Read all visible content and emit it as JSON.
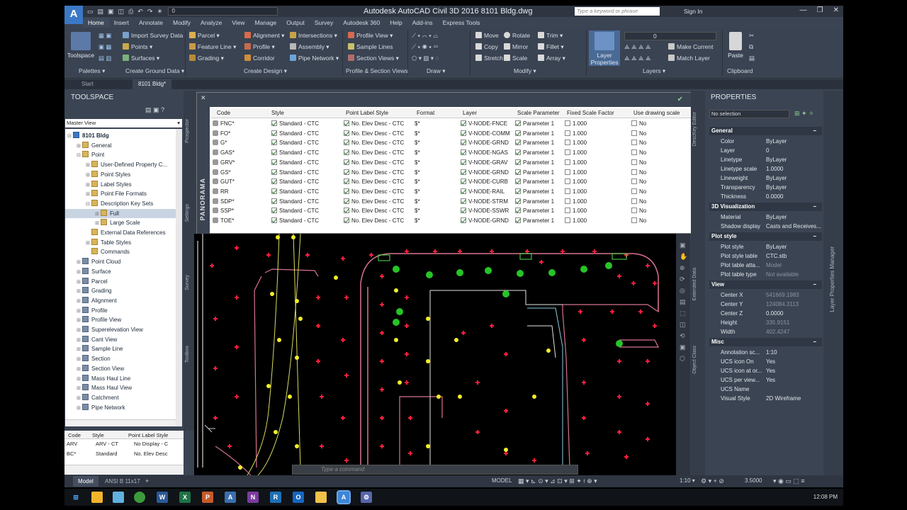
{
  "titlebar": {
    "app_icon": "A",
    "qat_items": [
      "new-icon",
      "open-icon",
      "save-icon",
      "saveas-icon",
      "print-icon",
      "undo-icon",
      "redo-icon",
      "layer-icon"
    ],
    "workspace_value": "0",
    "title": "Autodesk AutoCAD Civil 3D 2016   8101 Bldg.dwg",
    "search_placeholder": "Type a keyword or phrase",
    "signin": "Sign In",
    "window_controls": [
      "—",
      "❐",
      "✕"
    ]
  },
  "ribbon_tabs": [
    "Home",
    "Insert",
    "Annotate",
    "Modify",
    "Analyze",
    "View",
    "Manage",
    "Output",
    "Survey",
    "Autodesk 360",
    "Help",
    "Add-ins",
    "Express Tools"
  ],
  "ribbon": {
    "toolspace": "Toolspace",
    "import_survey": "Import Survey Data",
    "points": "Points",
    "surfaces": "Surfaces",
    "parcel": "Parcel",
    "feature_line": "Feature Line",
    "grading": "Grading",
    "alignment": "Alignment",
    "profile": "Profile",
    "corridor": "Corridor",
    "intersections": "Intersections",
    "assembly": "Assembly",
    "pipe_network": "Pipe Network",
    "profile_view": "Profile View",
    "sample_lines": "Sample Lines",
    "section_views": "Section Views",
    "move": "Move",
    "rotate": "Rotate",
    "trim": "Trim",
    "copy": "Copy",
    "mirror": "Mirror",
    "fillet": "Fillet",
    "stretch": "Stretch",
    "scale": "Scale",
    "array": "Array",
    "layer_properties": "Layer Properties",
    "make_current": "Make Current",
    "match_layer": "Match Layer",
    "layer_combo": "0",
    "paste": "Paste",
    "panels": [
      "Palettes",
      "Create Ground Data",
      "Create Design",
      "Profile & Section Views",
      "Draw",
      "Modify",
      "Layers",
      "Clipboard"
    ]
  },
  "file_tabs": [
    "Start",
    "8101 Bldg*"
  ],
  "toolspace": {
    "title": "TOOLSPACE",
    "view": "Master View",
    "side_tabs": [
      "Prospector",
      "Settings",
      "Survey",
      "Toolbox"
    ],
    "tree": [
      {
        "label": "8101 Bldg",
        "level": 0,
        "tog": "–",
        "bold": true
      },
      {
        "label": "General",
        "level": 1,
        "tog": "+"
      },
      {
        "label": "Point",
        "level": 1,
        "tog": "–"
      },
      {
        "label": "User-Defined Property C...",
        "level": 2,
        "tog": "+"
      },
      {
        "label": "Point Styles",
        "level": 2,
        "tog": "+"
      },
      {
        "label": "Label Styles",
        "level": 2,
        "tog": "+"
      },
      {
        "label": "Point File Formats",
        "level": 2,
        "tog": "+"
      },
      {
        "label": "Description Key Sets",
        "level": 2,
        "tog": "–"
      },
      {
        "label": "Full",
        "level": 3,
        "tog": "+",
        "selected": true
      },
      {
        "label": "Large Scale",
        "level": 3,
        "tog": "+"
      },
      {
        "label": "External Data References",
        "level": 2,
        "tog": ""
      },
      {
        "label": "Table Styles",
        "level": 2,
        "tog": "+"
      },
      {
        "label": "Commands",
        "level": 2,
        "tog": ""
      },
      {
        "label": "Point Cloud",
        "level": 1,
        "tog": "+"
      },
      {
        "label": "Surface",
        "level": 1,
        "tog": "+"
      },
      {
        "label": "Parcel",
        "level": 1,
        "tog": "+"
      },
      {
        "label": "Grading",
        "level": 1,
        "tog": "+"
      },
      {
        "label": "Alignment",
        "level": 1,
        "tog": "+"
      },
      {
        "label": "Profile",
        "level": 1,
        "tog": "+"
      },
      {
        "label": "Profile View",
        "level": 1,
        "tog": "+"
      },
      {
        "label": "Superelevation View",
        "level": 1,
        "tog": "+"
      },
      {
        "label": "Cant View",
        "level": 1,
        "tog": "+"
      },
      {
        "label": "Sample Line",
        "level": 1,
        "tog": "+"
      },
      {
        "label": "Section",
        "level": 1,
        "tog": "+"
      },
      {
        "label": "Section View",
        "level": 1,
        "tog": "+"
      },
      {
        "label": "Mass Haul Line",
        "level": 1,
        "tog": "+"
      },
      {
        "label": "Mass Haul View",
        "level": 1,
        "tog": "+"
      },
      {
        "label": "Catchment",
        "level": 1,
        "tog": "+"
      },
      {
        "label": "Pipe Network",
        "level": 1,
        "tog": "+"
      }
    ],
    "mini_headers": [
      "Code",
      "Style",
      "Point Label Style"
    ],
    "mini_rows": [
      [
        "ARV",
        "ARV - CT",
        "No Display - C"
      ],
      [
        "BC*",
        "Standard",
        "No. Elev Desc"
      ]
    ]
  },
  "panorama": {
    "label": "PANORAMA",
    "headers": [
      "Code",
      "Style",
      "Point Label Style",
      "Format",
      "Layer",
      "Scale Parameter",
      "Fixed Scale Factor",
      "Use drawing scale"
    ],
    "rows": [
      [
        "FNC*",
        "Standard - CTC",
        "No. Elev Desc - CTC",
        "$*",
        "V-NODE-FNCE",
        "Parameter 1",
        "1.000",
        "No"
      ],
      [
        "FO*",
        "Standard - CTC",
        "No. Elev Desc - CTC",
        "$*",
        "V-NODE-COMM",
        "Parameter 1",
        "1.000",
        "No"
      ],
      [
        "G*",
        "Standard - CTC",
        "No. Elev Desc - CTC",
        "$*",
        "V-NODE-GRND",
        "Parameter 1",
        "1.000",
        "No"
      ],
      [
        "GAS*",
        "Standard - CTC",
        "No. Elev Desc - CTC",
        "$*",
        "V-NODE-NGAS",
        "Parameter 1",
        "1.000",
        "No"
      ],
      [
        "GRV*",
        "Standard - CTC",
        "No. Elev Desc - CTC",
        "$*",
        "V-NODE-GRAV",
        "Parameter 1",
        "1.000",
        "No"
      ],
      [
        "GS*",
        "Standard - CTC",
        "No. Elev Desc - CTC",
        "$*",
        "V-NODE-GRND",
        "Parameter 1",
        "1.000",
        "No"
      ],
      [
        "GUT*",
        "Standard - CTC",
        "No. Elev Desc - CTC",
        "$*",
        "V-NODE-CURB",
        "Parameter 1",
        "1.000",
        "No"
      ],
      [
        "RR",
        "Standard - CTC",
        "No. Elev Desc - CTC",
        "$*",
        "V-NODE-RAIL",
        "Parameter 1",
        "1.000",
        "No"
      ],
      [
        "SDP*",
        "Standard - CTC",
        "No. Elev Desc - CTC",
        "$*",
        "V-NODE-STRM",
        "Parameter 1",
        "1.000",
        "No"
      ],
      [
        "SSP*",
        "Standard - CTC",
        "No. Elev Desc - CTC",
        "$*",
        "V-NODE-SSWR",
        "Parameter 1",
        "1.000",
        "No"
      ],
      [
        "TOE*",
        "Standard - CTC",
        "No. Elev Desc - CTC",
        "$*",
        "V-NODE-GRND",
        "Parameter 1",
        "1.000",
        "No"
      ]
    ]
  },
  "drawing": {
    "command_placeholder": "Type a command"
  },
  "side_tabs_right": [
    "DescKey Editor",
    "Extended Data",
    "Object Class"
  ],
  "properties": {
    "title": "PROPERTIES",
    "selection": "No selection",
    "side_tab": "Layer Properties Manager",
    "categories": [
      {
        "name": "General",
        "rows": [
          [
            "Color",
            "ByLayer"
          ],
          [
            "Layer",
            "0"
          ],
          [
            "Linetype",
            "ByLayer"
          ],
          [
            "Linetype scale",
            "1.0000"
          ],
          [
            "Lineweight",
            "ByLayer"
          ],
          [
            "Transparency",
            "ByLayer"
          ],
          [
            "Thickness",
            "0.0000"
          ]
        ]
      },
      {
        "name": "3D Visualization",
        "rows": [
          [
            "Material",
            "ByLayer"
          ],
          [
            "Shadow display",
            "Casts and Receives..."
          ]
        ]
      },
      {
        "name": "Plot style",
        "rows": [
          [
            "Plot style",
            "ByLayer"
          ],
          [
            "Plot style table",
            "CTC.stb"
          ],
          [
            "Plot table atta...",
            "Model"
          ],
          [
            "Plot table type",
            "Not available"
          ]
        ]
      },
      {
        "name": "View",
        "rows": [
          [
            "Center X",
            "541669.1983"
          ],
          [
            "Center Y",
            "124084.3113"
          ],
          [
            "Center Z",
            "0.0000"
          ],
          [
            "Height",
            "335.9151"
          ],
          [
            "Width",
            "402.4247"
          ]
        ]
      },
      {
        "name": "Misc",
        "rows": [
          [
            "Annotation sc...",
            "1:10"
          ],
          [
            "UCS icon On",
            "Yes"
          ],
          [
            "UCS icon at or...",
            "Yes"
          ],
          [
            "UCS per view...",
            "Yes"
          ],
          [
            "UCS Name",
            ""
          ],
          [
            "Visual Style",
            "2D Wireframe"
          ]
        ]
      }
    ]
  },
  "statusbar": {
    "tabs": [
      "Model",
      "ANSI B 11x17"
    ],
    "model": "MODEL",
    "annoscale": "1:10",
    "scale_value": "3.5000"
  },
  "taskbar": {
    "clock": "12:08 PM",
    "apps": [
      "windows-icon",
      "folder-icon",
      "chrome-icon",
      "explorer-icon",
      "word-icon",
      "excel-icon",
      "powerpoint-icon",
      "autocad-icon",
      "onenote-icon",
      "recap-icon",
      "outlook-icon",
      "notes-icon",
      "civil3d-icon",
      "settings-icon"
    ]
  }
}
